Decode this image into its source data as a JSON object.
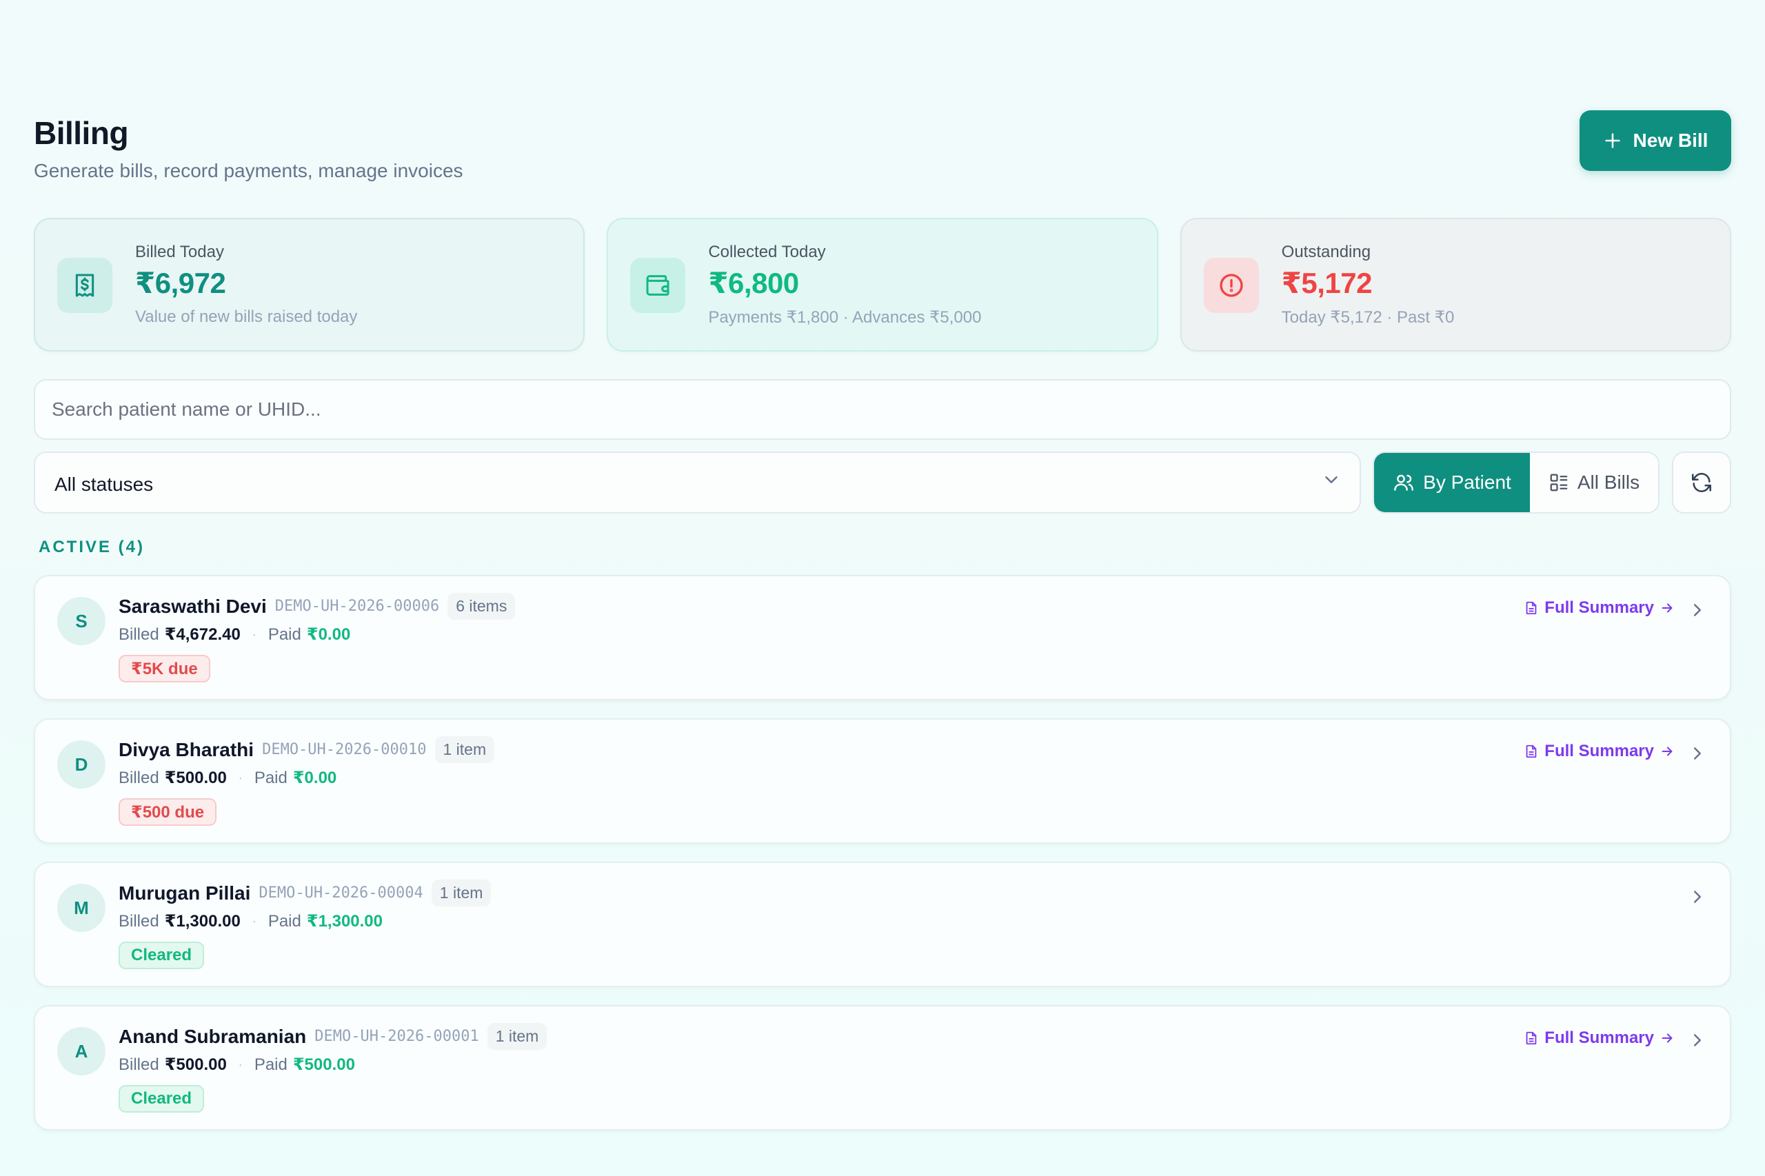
{
  "header": {
    "title": "Billing",
    "subtitle": "Generate bills, record payments, manage invoices",
    "new_bill_label": "New Bill",
    "new_bill_icon": "plus-icon"
  },
  "stats": [
    {
      "label": "Billed Today",
      "value": "₹6,972",
      "note": "Value of new bills raised today",
      "icon": "receipt-icon",
      "color": "#0f8f80"
    },
    {
      "label": "Collected Today",
      "value": "₹6,800",
      "note": "Payments ₹1,800 · Advances ₹5,000",
      "icon": "wallet-icon",
      "color": "#10b981"
    },
    {
      "label": "Outstanding",
      "value": "₹5,172",
      "note": "Today ₹5,172 · Past ₹0",
      "icon": "alert-circle-icon",
      "color": "#ef4444"
    }
  ],
  "search": {
    "placeholder": "Search patient name or UHID...",
    "value": ""
  },
  "filters": {
    "status_selected": "All statuses",
    "view_by_patient": "By Patient",
    "view_all_bills": "All Bills",
    "active_view": "By Patient"
  },
  "section_label": "ACTIVE (4)",
  "patients": [
    {
      "initial": "S",
      "name": "Saraswathi Devi",
      "uhid": "DEMO-UH-2026-00006",
      "items": "6 items",
      "billed_label": "Billed",
      "billed": "₹4,672.40",
      "paid_label": "Paid",
      "paid": "₹0.00",
      "badge": "₹5K due",
      "badge_type": "due",
      "summary": "Full Summary"
    },
    {
      "initial": "D",
      "name": "Divya Bharathi",
      "uhid": "DEMO-UH-2026-00010",
      "items": "1 item",
      "billed_label": "Billed",
      "billed": "₹500.00",
      "paid_label": "Paid",
      "paid": "₹0.00",
      "badge": "₹500 due",
      "badge_type": "due",
      "summary": "Full Summary"
    },
    {
      "initial": "M",
      "name": "Murugan Pillai",
      "uhid": "DEMO-UH-2026-00004",
      "items": "1 item",
      "billed_label": "Billed",
      "billed": "₹1,300.00",
      "paid_label": "Paid",
      "paid": "₹1,300.00",
      "badge": "Cleared",
      "badge_type": "cleared",
      "summary": ""
    },
    {
      "initial": "A",
      "name": "Anand Subramanian",
      "uhid": "DEMO-UH-2026-00001",
      "items": "1 item",
      "billed_label": "Billed",
      "billed": "₹500.00",
      "paid_label": "Paid",
      "paid": "₹500.00",
      "badge": "Cleared",
      "badge_type": "cleared",
      "summary": "Full Summary"
    }
  ],
  "colors": {
    "brand": "#0f8f80",
    "success": "#10b981",
    "danger": "#ef4444",
    "link": "#7c3aed"
  }
}
